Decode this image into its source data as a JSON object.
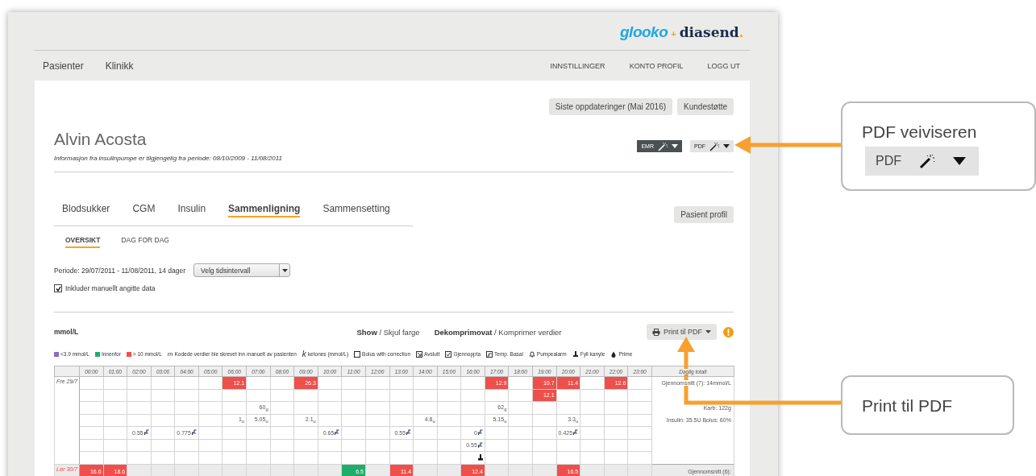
{
  "logo": {
    "word1": "glooko",
    "plus": "+",
    "word2": "diasend",
    "dot": "."
  },
  "nav": {
    "left": [
      "Pasienter",
      "Klinikk"
    ],
    "right": [
      "INNSTILLINGER",
      "KONTO PROFIL",
      "LOGG UT"
    ]
  },
  "top_buttons": [
    "Siste oppdateringer (Mai 2016)",
    "Kundestøtte"
  ],
  "patient": {
    "name": "Alvin Acosta",
    "info": "Informasjon fra insulinpumpe er tilgjengelig fra periode: 08/10/2009 - 11/08/2011"
  },
  "export_buttons": [
    {
      "label": "EMR",
      "kind": "dark"
    },
    {
      "label": "PDF",
      "kind": "light"
    }
  ],
  "tabs": [
    {
      "label": "Blodsukker",
      "selected": false
    },
    {
      "label": "CGM",
      "selected": false
    },
    {
      "label": "Insulin",
      "selected": false
    },
    {
      "label": "Sammenligning",
      "selected": true
    },
    {
      "label": "Sammensetting",
      "selected": false
    }
  ],
  "profile_button": "Pasient profil",
  "subtabs": [
    {
      "label": "OVERSIKT",
      "selected": true
    },
    {
      "label": "DAG FOR DAG",
      "selected": false
    }
  ],
  "period": {
    "label": "Periode: 29/07/2011 - 11/08/2011, 14 dager",
    "select_value": "Velg tidsintervall"
  },
  "include_manual": {
    "label": "Inkluder manuellt angitte data",
    "checked": true
  },
  "report": {
    "unit": "mmol/L",
    "color_toggle": "**Show** / Skjul farge",
    "compress_toggle": "**Dekomprimovat** / Komprimer verdier",
    "print_button": "Print til PDF"
  },
  "legend": [
    {
      "kind": "swatch",
      "color": "#8b6cc4",
      "label": "<3.9 mmol/L"
    },
    {
      "kind": "swatch",
      "color": "#1fae6a",
      "label": "Innenfor"
    },
    {
      "kind": "swatch",
      "color": "#ef4f4a",
      "label": "> 10 mmol/L"
    },
    {
      "kind": "letter",
      "symbol": "m",
      "label": "Kodede verdier ble skrevet inn manuelt av pasienten"
    },
    {
      "kind": "letter",
      "symbol": "k",
      "label": "ketones (mmol/L)"
    },
    {
      "kind": "square",
      "label": "Bolus with correction"
    },
    {
      "kind": "exit",
      "label": "Avslutt"
    },
    {
      "kind": "resume",
      "label": "Gjennoppta"
    },
    {
      "kind": "temp",
      "label": "Temp. Basal"
    },
    {
      "kind": "alarm",
      "label": "Pumpealarm"
    },
    {
      "kind": "fill",
      "label": "Fyll kanyle"
    },
    {
      "kind": "prime",
      "label": "Prime"
    }
  ],
  "table": {
    "columns": [
      "00:00",
      "01:00",
      "02:00",
      "03:00",
      "04:00",
      "05:00",
      "06:00",
      "07:00",
      "08:00",
      "09:00",
      "10:00",
      "11:00",
      "12:00",
      "13:00",
      "14:00",
      "15:00",
      "16:00",
      "17:00",
      "18:00",
      "19:00",
      "20:00",
      "21:00",
      "22:00",
      "23:00"
    ],
    "total_column": "Daglig totalt",
    "days": [
      {
        "label": "Fre 29/7",
        "weekend": false,
        "rows": [
          {
            "total": "Gjennomsnitt (7): 14mmol/L",
            "cells": [
              null,
              null,
              null,
              null,
              null,
              null,
              {
                "value": "12.1",
                "color": "#ef4f4a"
              },
              null,
              null,
              {
                "value": "26.3",
                "color": "#ef4f4a"
              },
              null,
              null,
              null,
              null,
              null,
              null,
              null,
              {
                "value": "12.9",
                "color": "#ef4f4a"
              },
              null,
              {
                "value": "10.7",
                "color": "#ef4f4a"
              },
              {
                "value": "11.4",
                "color": "#ef4f4a"
              },
              null,
              {
                "value": "12.6",
                "color": "#ef4f4a"
              },
              null
            ]
          },
          {
            "cells": [
              null,
              null,
              null,
              null,
              null,
              null,
              null,
              null,
              null,
              null,
              null,
              null,
              null,
              null,
              null,
              null,
              null,
              null,
              null,
              {
                "value": "12.1",
                "color": "#ef4f4a"
              },
              null,
              null,
              null,
              null
            ]
          },
          {
            "total": "Karb: 122g",
            "cells": [
              null,
              null,
              null,
              null,
              null,
              null,
              null,
              {
                "value": "60$_{g}$"
              },
              null,
              null,
              null,
              null,
              null,
              null,
              null,
              null,
              null,
              {
                "value": "62$_{g}$"
              },
              null,
              null,
              null,
              null,
              null,
              null
            ]
          },
          {
            "total": "Insulin: 35.5U Bolus: 60%",
            "cells": [
              null,
              null,
              null,
              null,
              null,
              null,
              {
                "value": "1$_{u}$"
              },
              {
                "value": "5.05$_{u}$"
              },
              null,
              {
                "value": "2.1$_{u}$"
              },
              null,
              null,
              null,
              null,
              {
                "value": "4.8$_{u}$"
              },
              null,
              null,
              {
                "value": "5.15$_{u}$"
              },
              null,
              null,
              {
                "value": "3.3$_{u}$"
              },
              null,
              null,
              null
            ]
          },
          {
            "cells": [
              null,
              null,
              {
                "value": "0.55",
                "kind": "basal"
              },
              null,
              {
                "value": "0.775",
                "kind": "basal"
              },
              null,
              null,
              null,
              null,
              null,
              {
                "value": "0.65",
                "kind": "basal"
              },
              null,
              null,
              {
                "value": "0.55",
                "kind": "basal"
              },
              null,
              null,
              {
                "value": "0",
                "kind": "basal"
              },
              null,
              null,
              null,
              {
                "value": "0.425",
                "kind": "basal"
              },
              null,
              null,
              null
            ]
          },
          {
            "cells": [
              null,
              null,
              null,
              null,
              null,
              null,
              null,
              null,
              null,
              null,
              null,
              null,
              null,
              null,
              null,
              null,
              {
                "value": "0.55",
                "kind": "basal"
              },
              null,
              null,
              null,
              null,
              null,
              null,
              null
            ]
          },
          {
            "cells": [
              null,
              null,
              null,
              null,
              null,
              null,
              null,
              null,
              null,
              null,
              null,
              null,
              null,
              null,
              null,
              null,
              {
                "kind": "fill"
              },
              null,
              null,
              null,
              null,
              null,
              null,
              null
            ]
          }
        ]
      },
      {
        "label": "Lør 30/7",
        "weekend": true,
        "rows": [
          {
            "total": "Gjennomsnitt (6):",
            "cells": [
              {
                "value": "16.6",
                "color": "#ef4f4a"
              },
              {
                "value": "18.6",
                "color": "#ef4f4a"
              },
              null,
              null,
              null,
              null,
              null,
              null,
              null,
              null,
              null,
              {
                "value": "6.5",
                "color": "#1fae6a"
              },
              null,
              {
                "value": "11.4",
                "color": "#ef4f4a"
              },
              null,
              null,
              {
                "value": "12.4",
                "color": "#ef4f4a"
              },
              null,
              null,
              null,
              {
                "value": "16.5",
                "color": "#ef4f4a"
              },
              null,
              null,
              null
            ]
          }
        ]
      }
    ]
  },
  "callouts": [
    {
      "title": "PDF veiviseren",
      "preview": {
        "label": "PDF"
      }
    },
    {
      "title": "Print til PDF"
    }
  ]
}
